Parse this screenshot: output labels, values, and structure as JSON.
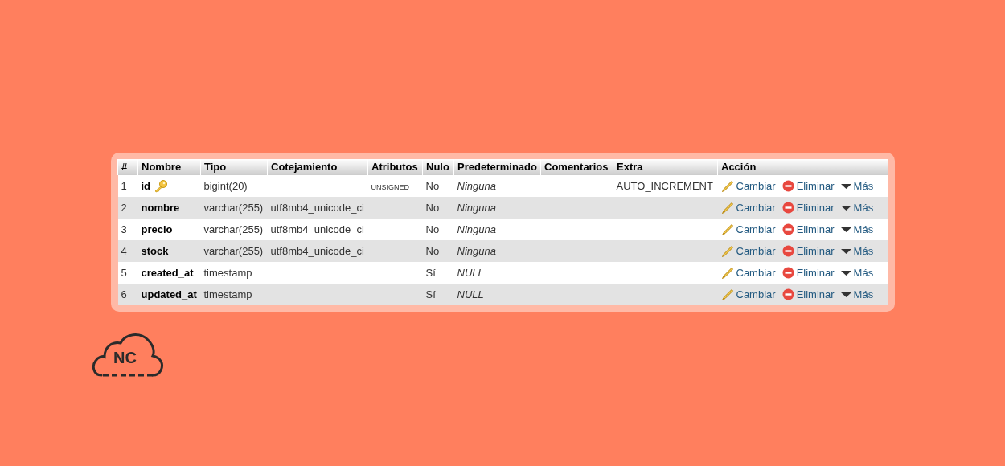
{
  "table": {
    "columns": [
      "#",
      "Nombre",
      "Tipo",
      "Cotejamiento",
      "Atributos",
      "Nulo",
      "Predeterminado",
      "Comentarios",
      "Extra",
      "Acción"
    ],
    "rows": [
      {
        "num": "1",
        "name": "id",
        "primary_key": true,
        "type": "bigint(20)",
        "collation": "",
        "attributes": "UNSIGNED",
        "null": "No",
        "default": "Ninguna",
        "comments": "",
        "extra": "AUTO_INCREMENT",
        "actions": [
          {
            "kind": "edit",
            "label": "Cambiar"
          },
          {
            "kind": "drop",
            "label": "Eliminar"
          },
          {
            "kind": "more",
            "label": "Más"
          }
        ]
      },
      {
        "num": "2",
        "name": "nombre",
        "primary_key": false,
        "type": "varchar(255)",
        "collation": "utf8mb4_unicode_ci",
        "attributes": "",
        "null": "No",
        "default": "Ninguna",
        "comments": "",
        "extra": "",
        "actions": [
          {
            "kind": "edit",
            "label": "Cambiar"
          },
          {
            "kind": "drop",
            "label": "Eliminar"
          },
          {
            "kind": "more",
            "label": "Más"
          }
        ]
      },
      {
        "num": "3",
        "name": "precio",
        "primary_key": false,
        "type": "varchar(255)",
        "collation": "utf8mb4_unicode_ci",
        "attributes": "",
        "null": "No",
        "default": "Ninguna",
        "comments": "",
        "extra": "",
        "actions": [
          {
            "kind": "edit",
            "label": "Cambiar"
          },
          {
            "kind": "drop",
            "label": "Eliminar"
          },
          {
            "kind": "more",
            "label": "Más"
          }
        ]
      },
      {
        "num": "4",
        "name": "stock",
        "primary_key": false,
        "type": "varchar(255)",
        "collation": "utf8mb4_unicode_ci",
        "attributes": "",
        "null": "No",
        "default": "Ninguna",
        "comments": "",
        "extra": "",
        "actions": [
          {
            "kind": "edit",
            "label": "Cambiar"
          },
          {
            "kind": "drop",
            "label": "Eliminar"
          },
          {
            "kind": "more",
            "label": "Más"
          }
        ]
      },
      {
        "num": "5",
        "name": "created_at",
        "primary_key": false,
        "type": "timestamp",
        "collation": "",
        "attributes": "",
        "null": "Sí",
        "default": "NULL",
        "comments": "",
        "extra": "",
        "actions": [
          {
            "kind": "edit",
            "label": "Cambiar"
          },
          {
            "kind": "drop",
            "label": "Eliminar"
          },
          {
            "kind": "more",
            "label": "Más"
          }
        ]
      },
      {
        "num": "6",
        "name": "updated_at",
        "primary_key": false,
        "type": "timestamp",
        "collation": "",
        "attributes": "",
        "null": "Sí",
        "default": "NULL",
        "comments": "",
        "extra": "",
        "actions": [
          {
            "kind": "edit",
            "label": "Cambiar"
          },
          {
            "kind": "drop",
            "label": "Eliminar"
          },
          {
            "kind": "more",
            "label": "Más"
          }
        ]
      }
    ]
  },
  "logo": {
    "text": "NC"
  }
}
